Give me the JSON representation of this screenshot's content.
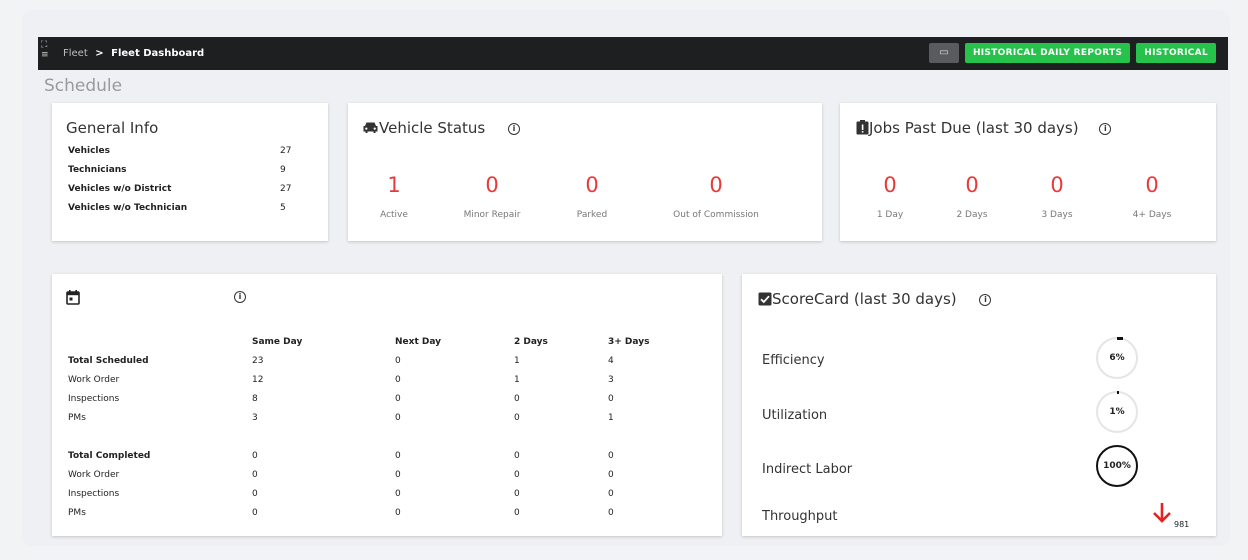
{
  "breadcrumb": {
    "parent": "Fleet",
    "separator": ">",
    "current": "Fleet Dashboard"
  },
  "topbar": {
    "camera_icon": "camera-icon",
    "btn_daily": "HISTORICAL DAILY REPORTS",
    "btn_historical": "HISTORICAL"
  },
  "page_title": "Schedule",
  "general_info": {
    "title": "General Info",
    "rows": [
      {
        "label": "Vehicles",
        "value": "27"
      },
      {
        "label": "Technicians",
        "value": "9"
      },
      {
        "label": "Vehicles w/o District",
        "value": "27"
      },
      {
        "label": "Vehicles w/o Technician",
        "value": "5"
      }
    ]
  },
  "vehicle_status": {
    "title": "Vehicle Status",
    "icon": "car-icon",
    "stats": [
      {
        "value": "1",
        "label": "Active"
      },
      {
        "value": "0",
        "label": "Minor Repair"
      },
      {
        "value": "0",
        "label": "Parked"
      },
      {
        "value": "0",
        "label": "Out of Commission"
      }
    ]
  },
  "jobs_past_due": {
    "title": "Jobs Past Due (last 30 days)",
    "icon": "clipboard-alert-icon",
    "stats": [
      {
        "value": "0",
        "label": "1 Day"
      },
      {
        "value": "0",
        "label": "2 Days"
      },
      {
        "value": "0",
        "label": "3 Days"
      },
      {
        "value": "0",
        "label": "4+ Days"
      }
    ]
  },
  "schedule_table": {
    "icon": "calendar-icon",
    "headers": [
      "Same Day",
      "Next Day",
      "2 Days",
      "3+ Days"
    ],
    "rows": [
      {
        "label": "Total Scheduled",
        "bold": true,
        "values": [
          "23",
          "0",
          "1",
          "4"
        ]
      },
      {
        "label": "Work Order",
        "bold": false,
        "values": [
          "12",
          "0",
          "1",
          "3"
        ]
      },
      {
        "label": "Inspections",
        "bold": false,
        "values": [
          "8",
          "0",
          "0",
          "0"
        ]
      },
      {
        "label": "PMs",
        "bold": false,
        "values": [
          "3",
          "0",
          "0",
          "1"
        ]
      },
      {
        "label": "Total Completed",
        "bold": true,
        "values": [
          "0",
          "0",
          "0",
          "0"
        ]
      },
      {
        "label": "Work Order",
        "bold": false,
        "values": [
          "0",
          "0",
          "0",
          "0"
        ]
      },
      {
        "label": "Inspections",
        "bold": false,
        "values": [
          "0",
          "0",
          "0",
          "0"
        ]
      },
      {
        "label": "PMs",
        "bold": false,
        "values": [
          "0",
          "0",
          "0",
          "0"
        ]
      }
    ]
  },
  "scorecard": {
    "title": "ScoreCard (last 30 days)",
    "icon": "checkbox-icon",
    "items": [
      {
        "label": "Efficiency",
        "value": "6%",
        "percent": 6
      },
      {
        "label": "Utilization",
        "value": "1%",
        "percent": 1
      },
      {
        "label": "Indirect Labor",
        "value": "100%",
        "percent": 100
      },
      {
        "label": "Throughput",
        "value": "981",
        "trend": "down",
        "trend_color": "#e52121"
      }
    ]
  },
  "colors": {
    "accent_green": "#27c24c",
    "stat_red": "#e83a3a",
    "topbar": "#1e1f21"
  }
}
